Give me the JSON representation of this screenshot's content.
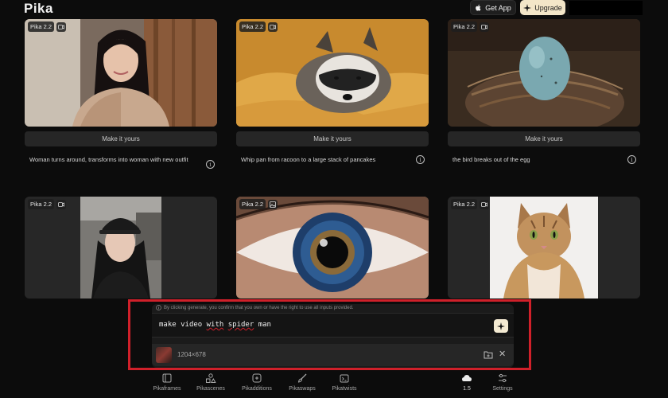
{
  "app": {
    "logo": "Pika"
  },
  "header": {
    "get_app_label": "Get App",
    "upgrade_label": "Upgrade"
  },
  "cards": [
    {
      "badge": "Pika 2.2",
      "cta": "Make it yours",
      "description": "Woman turns around, transforms into woman with new outfit"
    },
    {
      "badge": "Pika 2.2",
      "cta": "Make it yours",
      "description": "Whip pan from racoon to a large stack of pancakes"
    },
    {
      "badge": "Pika 2.2",
      "cta": "Make it yours",
      "description": "the bird breaks out of the egg"
    },
    {
      "badge": "Pika 2.2"
    },
    {
      "badge": "Pika 2.2"
    },
    {
      "badge": "Pika 2.2"
    }
  ],
  "prompt": {
    "notice": "By clicking generate, you confirm that you own or have the right to use all inputs provided.",
    "words": [
      "make",
      "video",
      "with",
      "spider",
      "man"
    ],
    "attachment_size": "1204×678"
  },
  "toolbar": {
    "items": [
      "Pikaframes",
      "Pikascenes",
      "Pikadditions",
      "Pikaswaps",
      "Pikatwists"
    ],
    "model_version": "1.5",
    "settings_label": "Settings"
  }
}
